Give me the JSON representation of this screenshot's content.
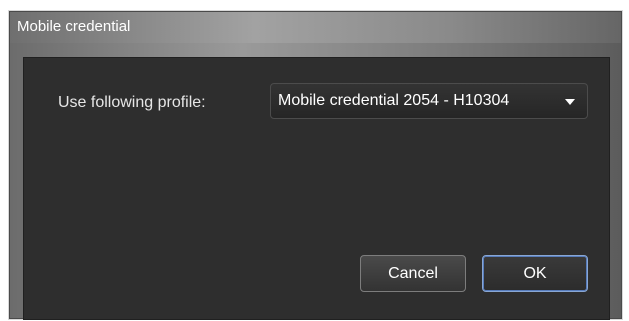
{
  "dialog": {
    "title": "Mobile credential",
    "profile_label": "Use following profile:",
    "profile_select": {
      "selected": "Mobile credential 2054 - H10304",
      "caret_icon": "chevron-down-icon"
    },
    "buttons": {
      "cancel": "Cancel",
      "ok": "OK"
    }
  },
  "colors": {
    "content_background": "#2e2e2e",
    "text": "#ffffff",
    "ok_focus_border": "#89a7d4"
  }
}
